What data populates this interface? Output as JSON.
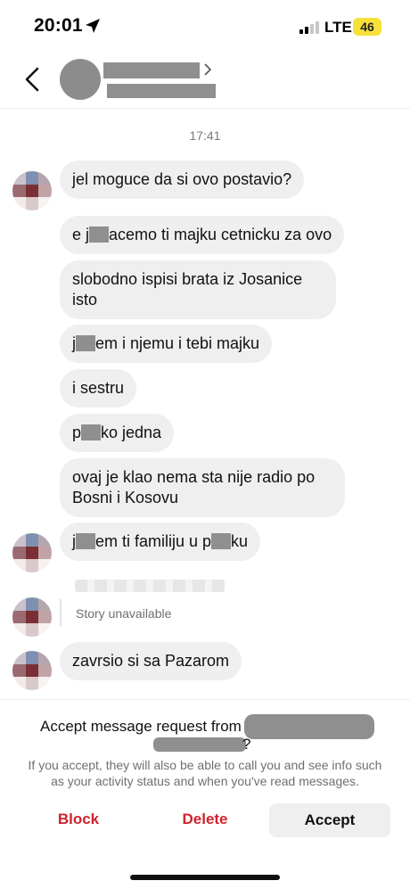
{
  "status_bar": {
    "time": "20:01",
    "network": "LTE",
    "battery": "46"
  },
  "chat": {
    "timestamp": "17:41",
    "messages": [
      {
        "parts": [
          "jel moguce da si ovo postavio?"
        ]
      },
      {
        "parts": [
          "e j",
          "acemo ti majku cetnicku za ovo"
        ]
      },
      {
        "parts": [
          "slobodno ispisi brata iz Josanice isto"
        ]
      },
      {
        "parts": [
          "j",
          "em i njemu i tebi majku"
        ]
      },
      {
        "parts": [
          "i sestru"
        ]
      },
      {
        "parts": [
          "p",
          "ko jedna"
        ]
      },
      {
        "parts": [
          "ovaj je klao nema sta nije radio po Bosni i Kosovu"
        ]
      },
      {
        "parts": [
          "j",
          "em ti familiju u p",
          "ku"
        ]
      },
      {
        "parts": [
          "zavrsio si sa Pazarom"
        ]
      }
    ],
    "story_unavailable": "Story unavailable"
  },
  "request": {
    "title": "Accept message request from",
    "question_mark": "?",
    "info": "If you accept, they will also be able to call you and see info such as your activity status and when you've read messages.",
    "block_label": "Block",
    "delete_label": "Delete",
    "accept_label": "Accept"
  },
  "colors": {
    "danger": "#d0222c",
    "bubble": "#efefef"
  }
}
